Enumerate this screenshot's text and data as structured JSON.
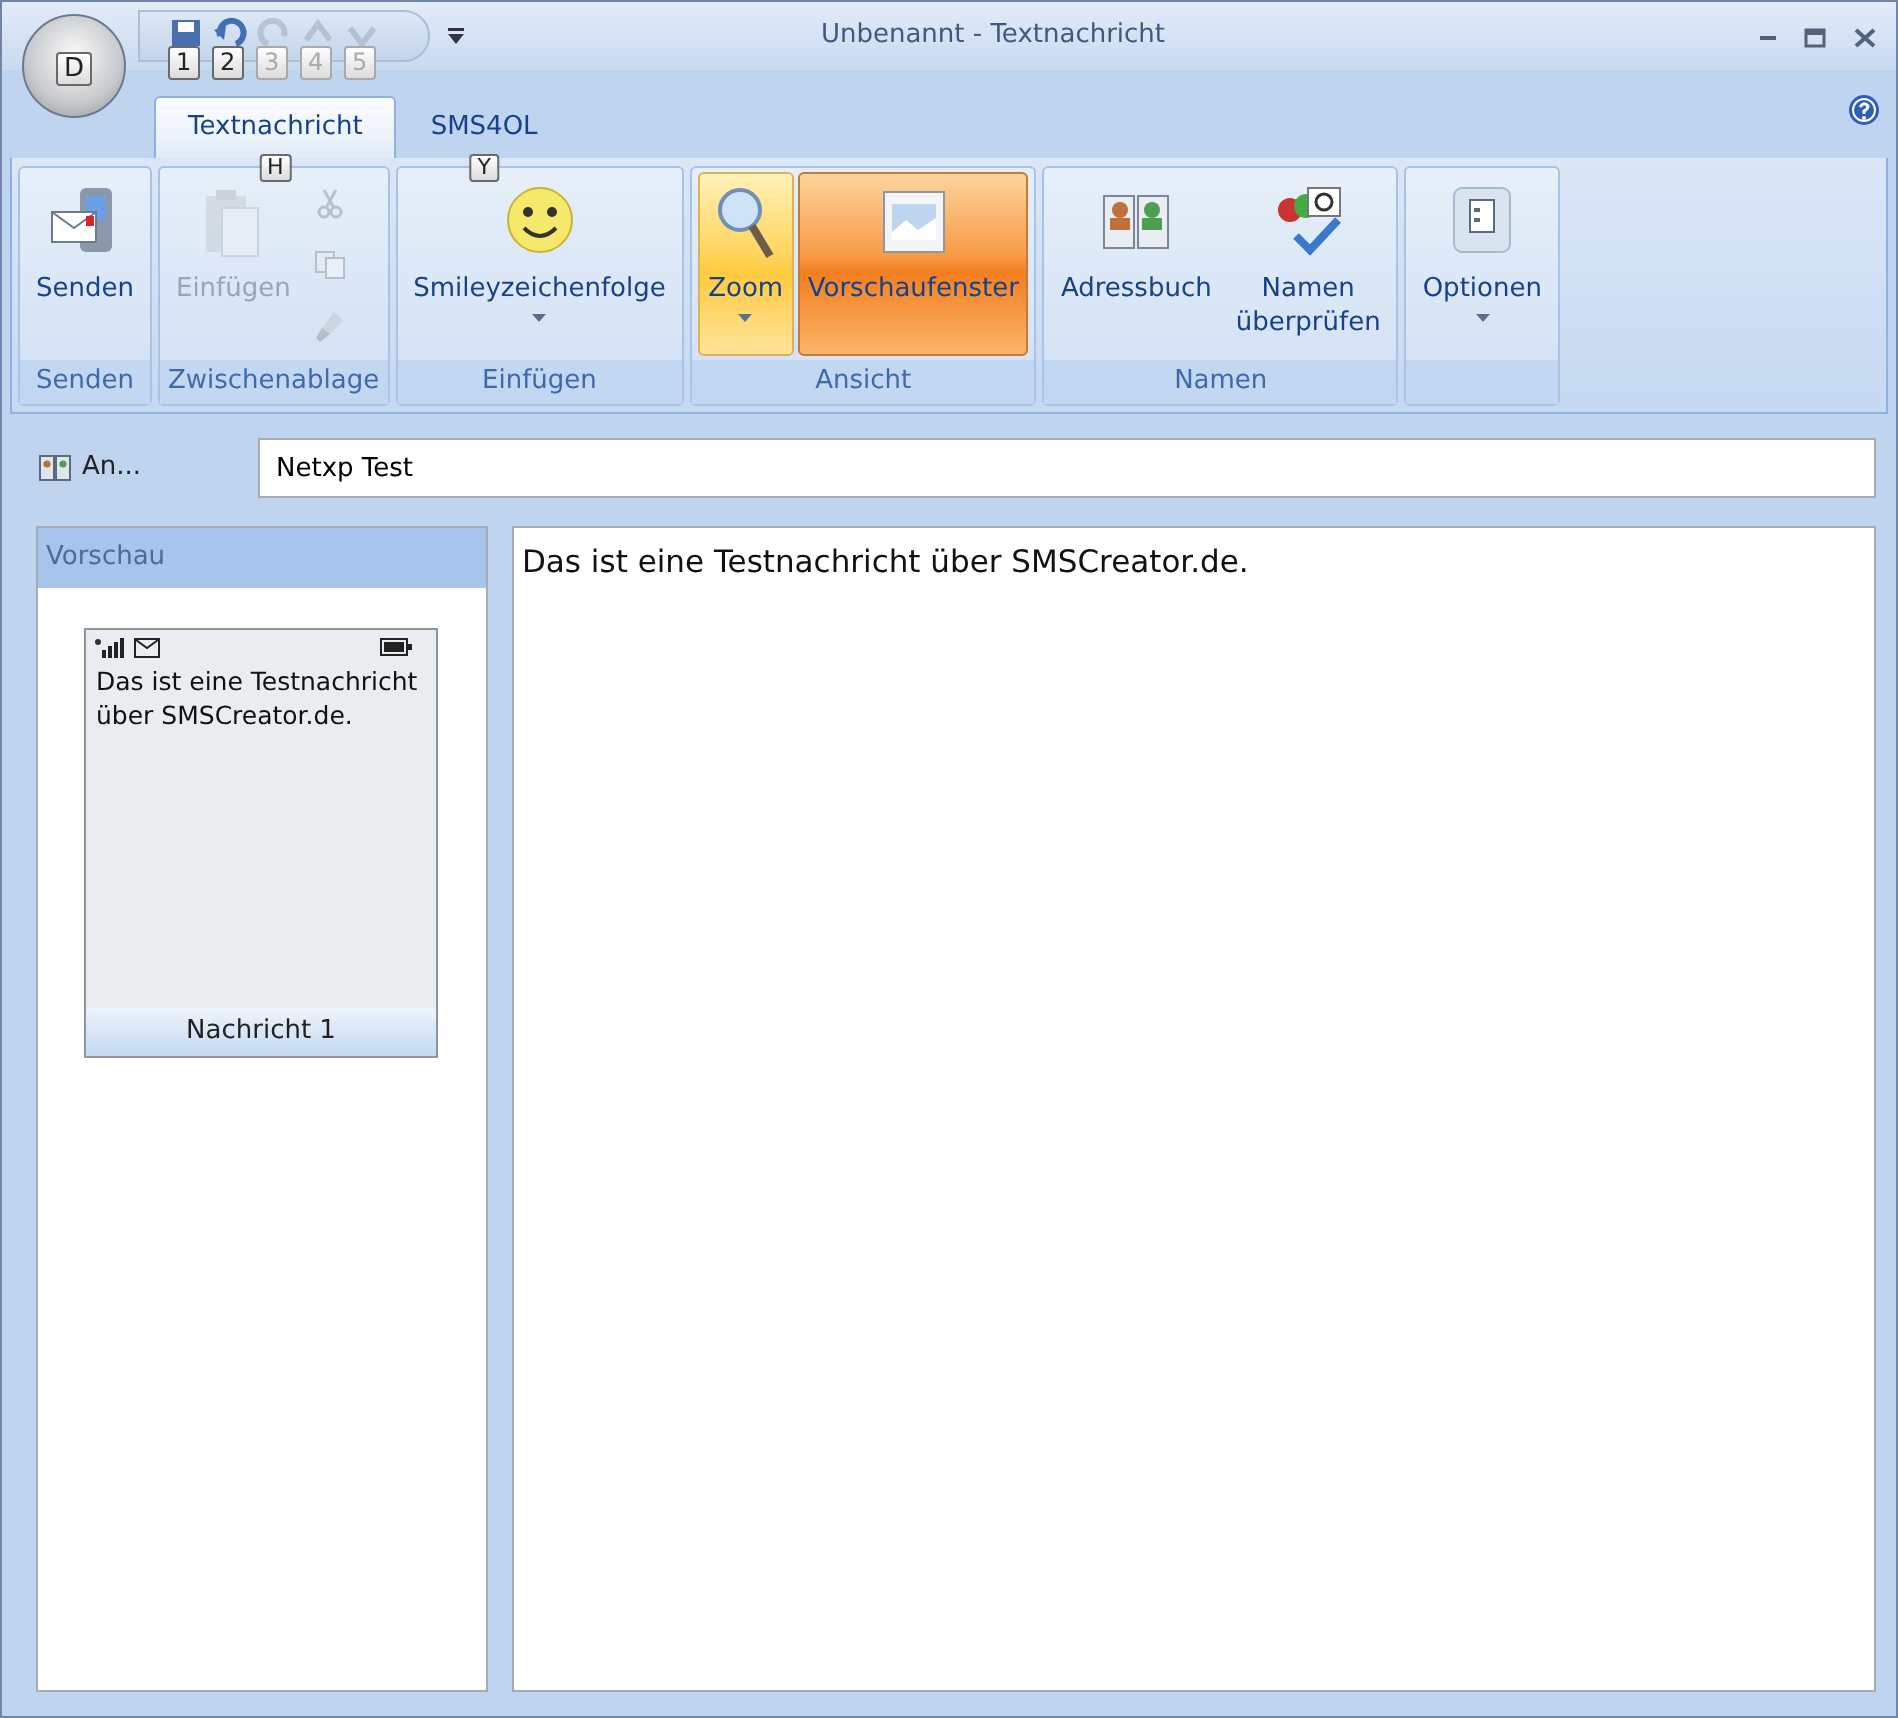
{
  "office_button": {
    "keytip": "D"
  },
  "quick_access": [
    {
      "keytip": "1",
      "disabled": false
    },
    {
      "keytip": "2",
      "disabled": false
    },
    {
      "keytip": "3",
      "disabled": true
    },
    {
      "keytip": "4",
      "disabled": true
    },
    {
      "keytip": "5",
      "disabled": true
    }
  ],
  "window": {
    "title": "Unbenannt - Textnachricht"
  },
  "tabs": [
    {
      "label": "Textnachricht",
      "selected": true,
      "keytip": "H"
    },
    {
      "label": "SMS4OL",
      "selected": false,
      "keytip": "Y"
    }
  ],
  "ribbon_groups": [
    {
      "label": "Senden",
      "commands": [
        {
          "kind": "large",
          "label": "Senden",
          "disabled": false,
          "dropdown": false,
          "hovered": false,
          "selected": false
        }
      ]
    },
    {
      "label": "Zwischenablage",
      "commands": [
        {
          "kind": "large",
          "label": "Einfügen",
          "disabled": true,
          "dropdown": false,
          "hovered": false,
          "selected": false
        },
        {
          "kind": "small",
          "disabled": true
        },
        {
          "kind": "small",
          "disabled": true
        },
        {
          "kind": "small",
          "disabled": true
        }
      ]
    },
    {
      "label": "Einfügen",
      "commands": [
        {
          "kind": "large",
          "label": "Smileyzeichenfolge",
          "disabled": false,
          "dropdown": true,
          "hovered": false,
          "selected": false
        }
      ]
    },
    {
      "label": "Ansicht",
      "commands": [
        {
          "kind": "large",
          "label": "Zoom",
          "disabled": false,
          "dropdown": true,
          "hovered": true,
          "selected": false
        },
        {
          "kind": "large",
          "label": "Vorschaufenster",
          "disabled": false,
          "dropdown": false,
          "hovered": false,
          "selected": true
        }
      ]
    },
    {
      "label": "Namen",
      "commands": [
        {
          "kind": "large",
          "label": "Adressbuch",
          "disabled": false,
          "dropdown": false,
          "hovered": false,
          "selected": false
        },
        {
          "kind": "large",
          "label": "Namen überprüfen",
          "disabled": false,
          "dropdown": false,
          "hovered": false,
          "selected": false
        }
      ]
    },
    {
      "commands": [
        {
          "kind": "large",
          "label": "Optionen",
          "disabled": false,
          "dropdown": true,
          "hovered": false,
          "selected": false
        }
      ]
    }
  ],
  "recipient": {
    "label": "An...",
    "value": "Netxp Test"
  },
  "preview": {
    "title": "Vorschau",
    "messages": [
      {
        "text": "Das ist eine Testnachricht über SMSCreator.de.",
        "caption": "Nachricht 1"
      }
    ]
  },
  "message_body": "Das ist eine Testnachricht über SMSCreator.de."
}
